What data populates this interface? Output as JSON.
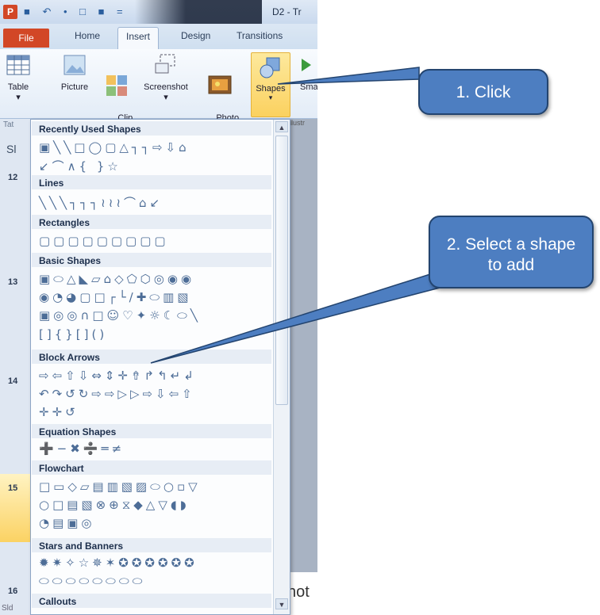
{
  "window": {
    "app_logo": "P",
    "quick_access": "■ ↶ • □ ■ =",
    "doc_title": "D2 - Tr"
  },
  "tabs": {
    "file": "File",
    "home": "Home",
    "insert": "Insert",
    "design": "Design",
    "transitions": "Transitions"
  },
  "ribbon": {
    "table": "Table",
    "table_drop": "▾",
    "picture": "Picture",
    "clip_art": "Clip\nArt",
    "screenshot": "Screenshot",
    "screenshot_drop": "▾",
    "photo_album": "Photo\nAlbum ▾",
    "shapes": "Shapes",
    "shapes_drop": "▾",
    "smart_cut": "Sma",
    "group_tab": "Tat",
    "group_illus": "llustr"
  },
  "left_panel": {
    "tab_stub": "Sl",
    "nums": [
      "12",
      "13",
      "14",
      "15",
      "16"
    ],
    "bottom_stub": "Sld"
  },
  "notes_stub": "hot",
  "gallery": {
    "categories": [
      {
        "title": "Recently Used Shapes",
        "rows": [
          "▣╲╲□◯▢△┐┐⇨⇩⌂",
          "↙⌒∧{ }☆"
        ]
      },
      {
        "title": "Lines",
        "rows": [
          "╲╲╲┐┐┐≀≀≀⌒⌂↙"
        ]
      },
      {
        "title": "Rectangles",
        "rows": [
          "▢▢▢▢▢▢▢▢▢"
        ]
      },
      {
        "title": "Basic Shapes",
        "rows": [
          "▣⬭△◣▱⌂◇⬠⬡◎◉◉",
          "◉◔◕▢□┌└∕✚⬭▥▧",
          "▣◎◎∩□☺♡✦☼☾⬭╲",
          "[]{}[]()"
        ]
      },
      {
        "title": "Block Arrows",
        "rows": [
          "⇨⇦⇧⇩⇔⇕✛⇮↱↰↵↲",
          "↶↷↺↻⇨⇨▷▷⇨⇩⇦⇧",
          "✛✛↺"
        ]
      },
      {
        "title": "Equation Shapes",
        "rows": [
          "➕−✖➗═≠"
        ]
      },
      {
        "title": "Flowchart",
        "rows": [
          "□▭◇▱▤▥▧▨⬭○▫▽",
          "○□▤▧⊗⊕⧖◆△▽◖◗",
          "◔▤▣◎"
        ]
      },
      {
        "title": "Stars and Banners",
        "rows": [
          "✹✷✧☆✵✶✪✪✪✪✪✪",
          "⬭⬭⬭⬭⬭⬭⬭⬭"
        ]
      },
      {
        "title": "Callouts",
        "rows": []
      }
    ],
    "scroll_up": "▲",
    "scroll_down": "▼"
  },
  "callouts": {
    "click": "1. Click",
    "select": "2. Select a shape to add"
  },
  "colors": {
    "callout_fill": "#4d7ec1",
    "callout_border": "#23446f",
    "file_tab": "#d24726",
    "shapes_highlight": "#fbd15f"
  }
}
